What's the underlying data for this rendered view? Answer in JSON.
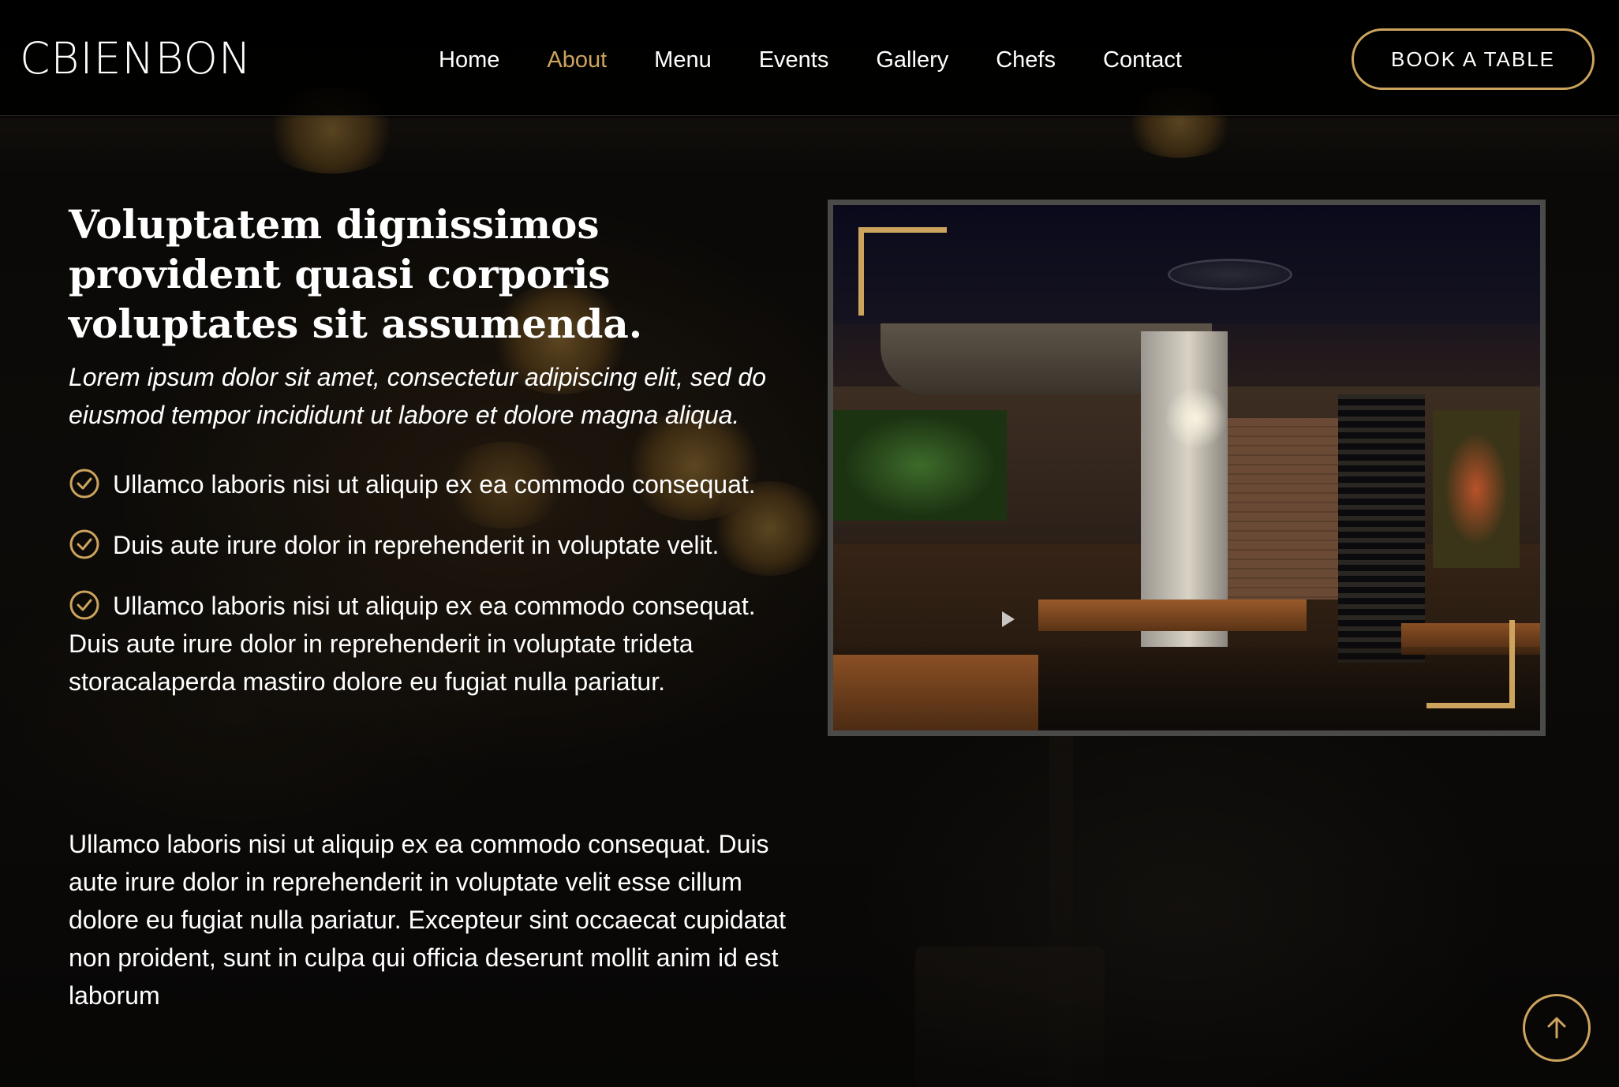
{
  "brand": {
    "logo": "CBIENBON",
    "accent_color": "#cda45e"
  },
  "nav": {
    "items": [
      {
        "label": "Home",
        "active": false
      },
      {
        "label": "About",
        "active": true
      },
      {
        "label": "Menu",
        "active": false
      },
      {
        "label": "Events",
        "active": false
      },
      {
        "label": "Gallery",
        "active": false
      },
      {
        "label": "Chefs",
        "active": false
      },
      {
        "label": "Contact",
        "active": false
      }
    ],
    "cta_label": "BOOK A TABLE"
  },
  "about": {
    "headline": "Voluptatem dignissimos provident quasi corporis voluptates sit assumenda.",
    "lead": "Lorem ipsum dolor sit amet, consectetur adipiscing elit, sed do eiusmod tempor incididunt ut labore et dolore magna aliqua.",
    "checks": [
      "Ullamco laboris nisi ut aliquip ex ea commodo consequat.",
      "Duis aute irure dolor in reprehenderit in voluptate velit.",
      "Ullamco laboris nisi ut aliquip ex ea commodo consequat. Duis aute irure dolor in reprehenderit in voluptate trideta storacalaperda mastiro dolore eu fugiat nulla pariatur."
    ],
    "paragraph": "Ullamco laboris nisi ut aliquip ex ea commodo consequat. Duis aute irure dolor in reprehenderit in voluptate velit esse cillum dolore eu fugiat nulla pariatur. Excepteur sint occaecat cupidatat non proident, sunt in culpa qui officia deserunt mollit anim id est laborum",
    "image_icon": "restaurant-interior-photo",
    "play_icon": "play-icon"
  },
  "icons": {
    "check": "check-circle-icon",
    "back_to_top": "arrow-up-icon"
  }
}
